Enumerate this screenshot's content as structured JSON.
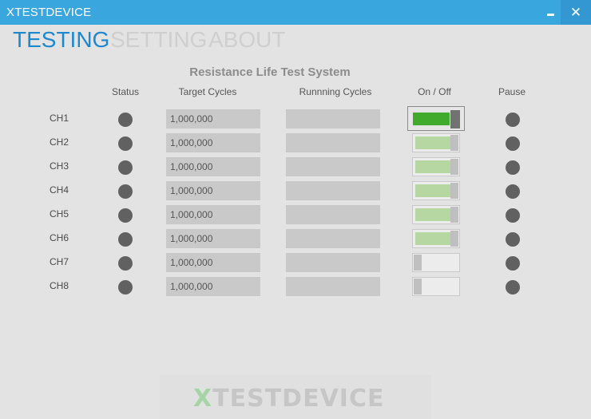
{
  "window": {
    "title": "XTESTDEVICE",
    "minimize_glyph": "",
    "close_glyph": "✕",
    "title_bar_color": "#3aa6de"
  },
  "tabs": [
    {
      "label": "TESTING",
      "active": true
    },
    {
      "label": "SETTING",
      "active": false
    },
    {
      "label": "ABOUT",
      "active": false
    }
  ],
  "system_title": "Resistance Life Test System",
  "columns": {
    "status": "Status",
    "target": "Target Cycles",
    "running": "Runnning Cycles",
    "onoff": "On / Off",
    "pause": "Pause"
  },
  "channels": [
    {
      "label": "CH1",
      "target": "1,000,000",
      "running": "",
      "switch": "on",
      "selected": true
    },
    {
      "label": "CH2",
      "target": "1,000,000",
      "running": "",
      "switch": "on",
      "selected": false
    },
    {
      "label": "CH3",
      "target": "1,000,000",
      "running": "",
      "switch": "on",
      "selected": false
    },
    {
      "label": "CH4",
      "target": "1,000,000",
      "running": "",
      "switch": "on",
      "selected": false
    },
    {
      "label": "CH5",
      "target": "1,000,000",
      "running": "",
      "switch": "on",
      "selected": false
    },
    {
      "label": "CH6",
      "target": "1,000,000",
      "running": "",
      "switch": "on",
      "selected": false
    },
    {
      "label": "CH7",
      "target": "1,000,000",
      "running": "",
      "switch": "off",
      "selected": false
    },
    {
      "label": "CH8",
      "target": "1,000,000",
      "running": "",
      "switch": "off",
      "selected": false
    }
  ],
  "logo": {
    "prefix": "X",
    "rest": "TESTDEVICE"
  },
  "colors": {
    "active_tab": "#1e88cf",
    "inactive_tab": "#cfcfcf",
    "switch_on": "#3faa2c",
    "switch_on_dim": "#b6d7a1",
    "indicator": "#616161"
  }
}
